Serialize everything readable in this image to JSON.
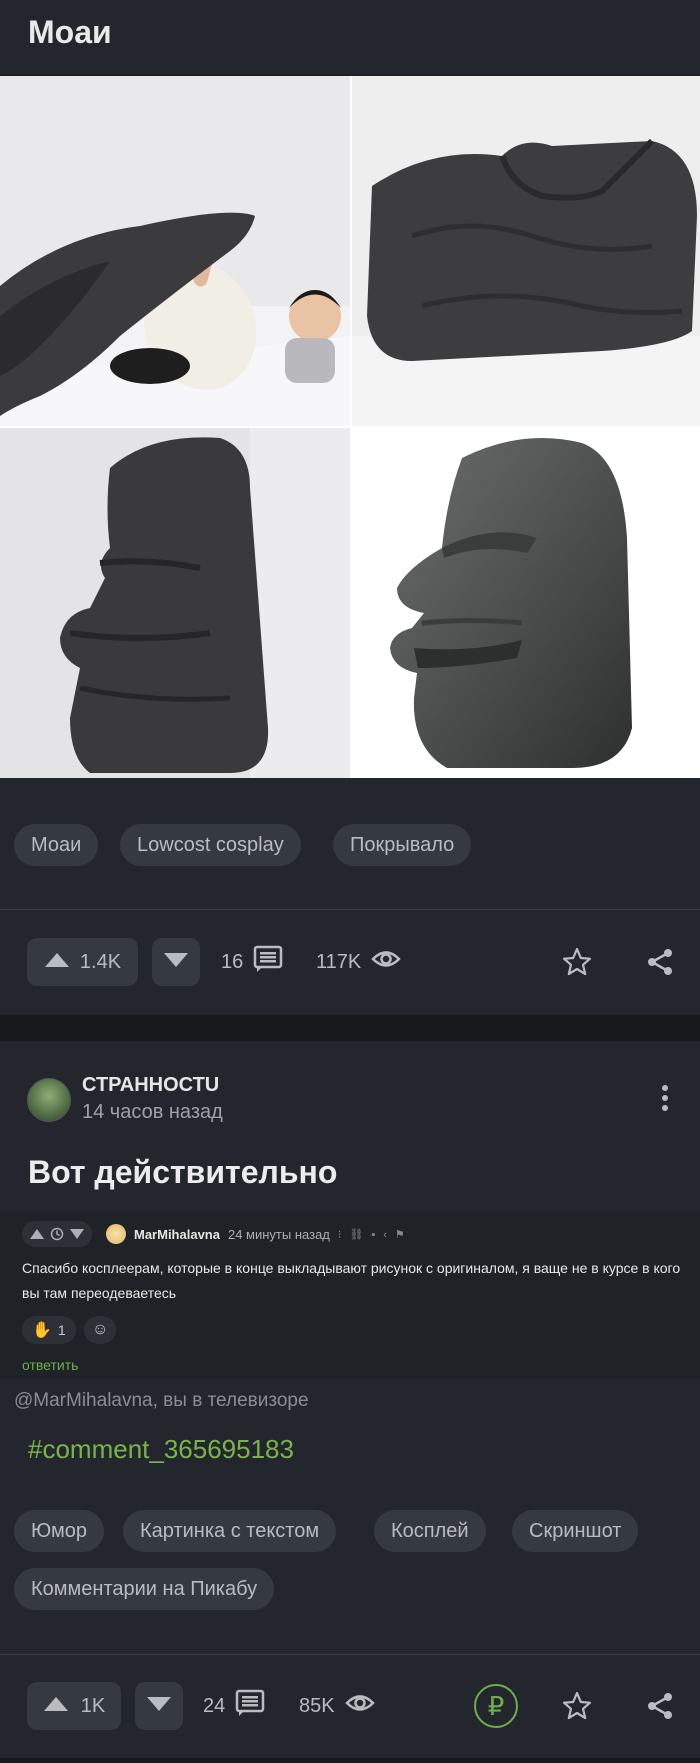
{
  "post1": {
    "title": "Моаи",
    "tags": [
      "Моаи",
      "Lowcost cosplay",
      "Покрывало"
    ],
    "actions": {
      "upvotes": "1.4K",
      "comments": "16",
      "views": "117K"
    }
  },
  "post2": {
    "author": "СТРАННОСТU",
    "time_ago": "14 часов назад",
    "title": "Вот действительно",
    "embedded_comment": {
      "user": "MarMihalavna",
      "time": "24 минуты назад",
      "text": "Спасибо косплеерам, которые в конце выкладывают рисунок с оригиналом, я ваще не в курсе в кого вы там переодеваетесь",
      "reaction_count": "1",
      "reply_label": "ответить"
    },
    "mention_text": "@MarMihalavna, вы в телевизоре",
    "hashtag": "#comment_365695183",
    "tags": [
      "Юмор",
      "Картинка с текстом",
      "Косплей",
      "Скриншот",
      "Комментарии на Пикабу"
    ],
    "actions": {
      "upvotes": "1K",
      "comments": "24",
      "views": "85K"
    }
  },
  "colors": {
    "background": "#23272d",
    "chip": "#353a41",
    "accent_green": "#6fae4a"
  },
  "icons": [
    "arrow-up-icon",
    "arrow-down-icon",
    "comment-icon",
    "eye-icon",
    "star-icon",
    "share-icon",
    "more-vertical-icon",
    "ruble-icon"
  ]
}
